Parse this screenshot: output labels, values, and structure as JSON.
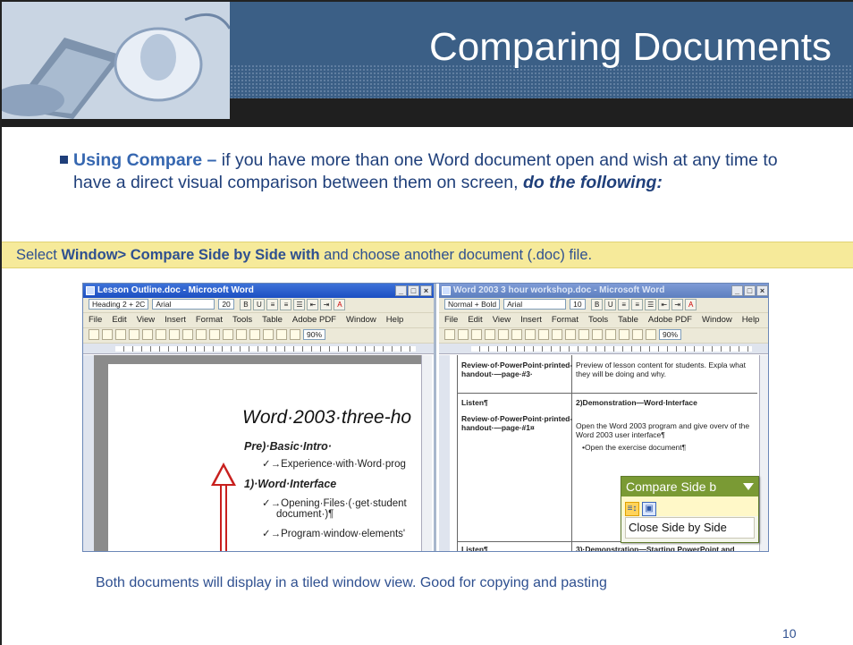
{
  "slide": {
    "title": "Comparing Documents",
    "bullet": {
      "lead": "Using Compare",
      "dash": " – ",
      "text": "if you have more than one Word document open and wish at any time to have a direct visual comparison between them on screen, ",
      "emphasis": "do the following:"
    },
    "instruction": {
      "prefix": "Select ",
      "command": "Window> Compare Side by Side with",
      "suffix": " and choose another document (.doc) file."
    },
    "caption": "Both documents will display in a tiled window view. Good for copying and pasting",
    "page_number": "10"
  },
  "screenshot": {
    "left_window": {
      "title": "Lesson Outline.doc - Microsoft Word",
      "style_box": "Heading 2 + 2C",
      "font_box": "Arial",
      "size_box": "20",
      "menus": [
        "File",
        "Edit",
        "View",
        "Insert",
        "Format",
        "Tools",
        "Table",
        "Adobe PDF",
        "Window",
        "Help"
      ],
      "zoom": "90%",
      "document": {
        "heading": "Word·2003·three-ho",
        "lines": [
          "Pre)·Basic·Intro·",
          "✓→Experience·with·Word·prog",
          "1)·Word·Interface",
          "✓→Opening·Files·(·get·student",
          "document·)¶",
          "✓→Program·window·elements'"
        ]
      }
    },
    "right_window": {
      "title": "Word 2003 3 hour workshop.doc - Microsoft Word",
      "style_box": "Normal + Bold",
      "font_box": "Arial",
      "size_box": "10",
      "menus": [
        "File",
        "Edit",
        "View",
        "Insert",
        "Format",
        "Tools",
        "Table",
        "Adobe PDF",
        "Window",
        "Help"
      ],
      "zoom": "90%",
      "table": {
        "r1_left": "Review·of·PowerPoint·printed-handout·—page·#3·",
        "r1_right": "Preview of lesson content for students. Expla what they will be doing and why.",
        "r2_left_a": "Listen¶",
        "r2_left_b": "Review·of·PowerPoint·printed-handout·—page·#1¤",
        "r2_right_a": "2)Demonstration—Word·Interface",
        "r2_right_b": "Open the Word 2003 program and give overv of the Word 2003 user interface¶",
        "r2_right_c": "•Open the exercise document¶",
        "r3_left": "Listen¶",
        "r3_right": "3)·Demonstration—Starting PowerPoint and"
      },
      "compare_toolbar": {
        "title": "Compare Side b",
        "close_label": "Close Side by Side"
      }
    }
  }
}
